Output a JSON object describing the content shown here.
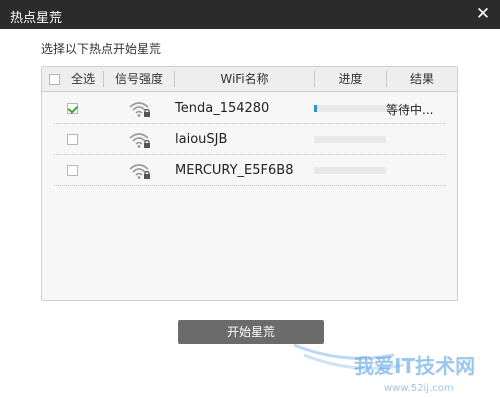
{
  "window": {
    "title": "热点星荒",
    "close_label": "✕"
  },
  "instruction": "选择以下热点开始星荒",
  "table": {
    "headers": {
      "select_all": "全选",
      "signal": "信号强度",
      "wifi_name": "WiFi名称",
      "progress": "进度",
      "result": "结果"
    },
    "rows": [
      {
        "checked": true,
        "name": "Tenda_154280",
        "progress": 0.04,
        "result": "等待中..."
      },
      {
        "checked": false,
        "name": "laiouSJB",
        "progress": 0,
        "result": ""
      },
      {
        "checked": false,
        "name": "MERCURY_E5F6B8",
        "progress": 0,
        "result": ""
      }
    ]
  },
  "start_button": "开始星荒",
  "watermark": {
    "text": "我爱IT技术网",
    "url": "www.52ij.com"
  },
  "colors": {
    "titlebar": "#2b2b2b",
    "progress": "#2f8fe0",
    "checkmark": "#3aa335",
    "button": "#6b6b6b"
  }
}
